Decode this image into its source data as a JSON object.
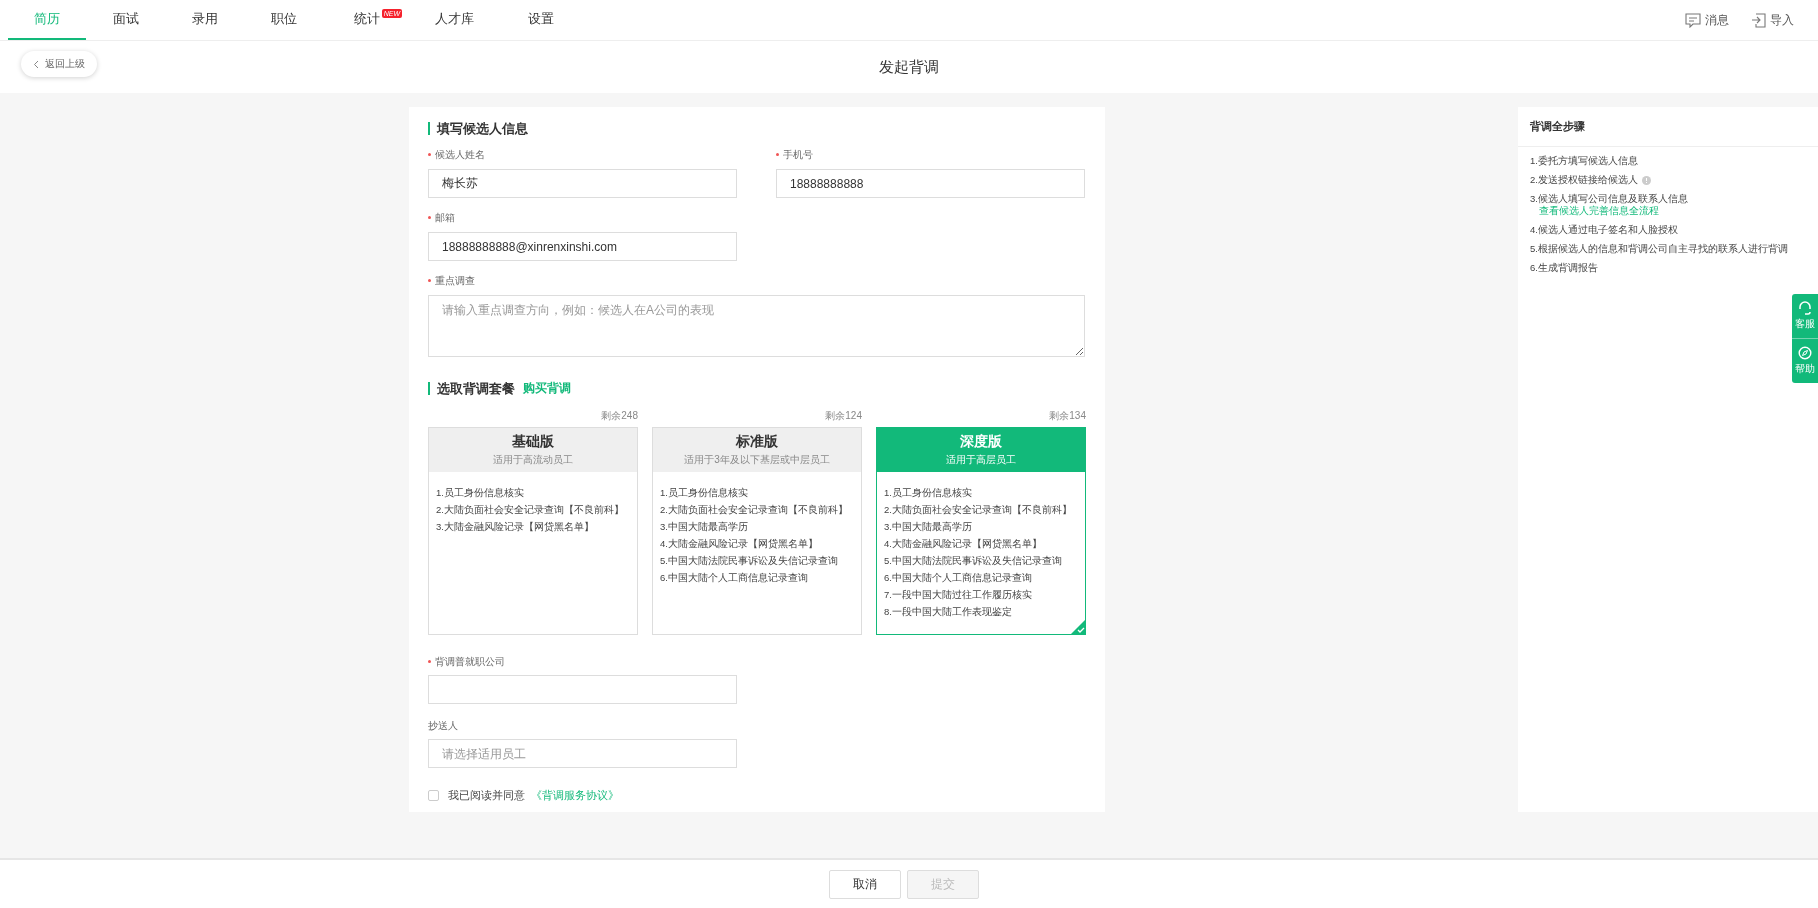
{
  "nav": {
    "tabs": [
      {
        "label": "简历",
        "selected": true
      },
      {
        "label": "面试",
        "selected": false
      },
      {
        "label": "录用",
        "selected": false
      },
      {
        "label": "职位",
        "selected": false
      },
      {
        "label": "统计",
        "selected": false,
        "badge": "NEW"
      },
      {
        "label": "人才库",
        "selected": false
      },
      {
        "label": "设置",
        "selected": false
      }
    ],
    "actions": [
      {
        "kind": "message",
        "label": "消息"
      },
      {
        "kind": "import",
        "label": "导入"
      }
    ]
  },
  "header": {
    "back": "返回上级",
    "title": "发起背调"
  },
  "candidate": {
    "title": "填写候选人信息",
    "fields": [
      {
        "kind": "input",
        "label": "候选人姓名",
        "required": true,
        "value": "梅长苏"
      },
      {
        "kind": "input",
        "label": "手机号",
        "required": true,
        "value": "18888888888"
      },
      {
        "kind": "input",
        "label": "邮箱",
        "required": true,
        "value": "18888888888@xinrenxinshi.com"
      },
      {
        "kind": "textarea",
        "label": "重点调查",
        "required": true,
        "placeholder": "请输入重点调查方向，例如：候选人在A公司的表现"
      }
    ]
  },
  "packages": {
    "title": "选取背调套餐",
    "buy_link": "购买背调",
    "plans": [
      {
        "remaining": "剩余248",
        "name": "基础版",
        "desc": "适用于高流动员工",
        "selected": false,
        "items": [
          "1.员工身份信息核实",
          "2.大陆负面社会安全记录查询【不良前科】",
          "3.大陆金融风险记录【网贷黑名单】"
        ]
      },
      {
        "remaining": "剩余124",
        "name": "标准版",
        "desc": "适用于3年及以下基层或中层员工",
        "selected": false,
        "items": [
          "1.员工身份信息核实",
          "2.大陆负面社会安全记录查询【不良前科】",
          "3.中国大陆最高学历",
          "4.大陆金融风险记录【网贷黑名单】",
          "5.中国大陆法院民事诉讼及失信记录查询",
          "6.中国大陆个人工商信息记录查询"
        ]
      },
      {
        "remaining": "剩余134",
        "name": "深度版",
        "desc": "适用于高层员工",
        "selected": true,
        "items": [
          "1.员工身份信息核实",
          "2.大陆负面社会安全记录查询【不良前科】",
          "3.中国大陆最高学历",
          "4.大陆金融风险记录【网贷黑名单】",
          "5.中国大陆法院民事诉讼及失信记录查询",
          "6.中国大陆个人工商信息记录查询",
          "7.一段中国大陆过往工作履历核实",
          "8.一段中国大陆工作表现鉴定"
        ]
      }
    ]
  },
  "extra_fields": [
    {
      "label": "背调普就职公司",
      "required": true
    },
    {
      "label": "抄送人",
      "required": false,
      "placeholder": "请选择适用员工"
    }
  ],
  "agreement": {
    "checked": false,
    "text": "我已阅读并同意",
    "link": "《背调服务协议》"
  },
  "steps": {
    "title": "背调全步骤",
    "items": [
      {
        "text": "1.委托方填写候选人信息"
      },
      {
        "text": "2.发送授权链接给候选人",
        "info": true
      },
      {
        "text": "3.候选人填写公司信息及联系人信息",
        "link": "查看候选人完善信息全流程"
      },
      {
        "text": "4.候选人通过电子签名和人脸授权"
      },
      {
        "text": "5.根据候选人的信息和背调公司自主寻找的联系人进行背调"
      },
      {
        "text": "6.生成背调报告"
      }
    ]
  },
  "float_tabs": [
    {
      "kind": "service",
      "label": "客服"
    },
    {
      "kind": "help",
      "label": "帮助"
    }
  ],
  "footer": [
    {
      "label": "取消",
      "disabled": false
    },
    {
      "label": "提交",
      "disabled": true
    }
  ]
}
